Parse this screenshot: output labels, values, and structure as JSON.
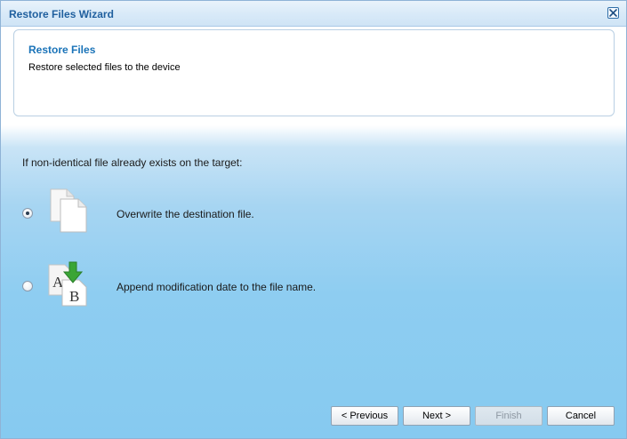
{
  "window": {
    "title": "Restore Files Wizard"
  },
  "header": {
    "title": "Restore Files",
    "subtitle": "Restore selected files to the device"
  },
  "question": "If non-identical file already exists on the target:",
  "options": [
    {
      "label": "Overwrite the destination file.",
      "selected": true,
      "icon": "overwrite-files-icon"
    },
    {
      "label": "Append modification date to the file name.",
      "selected": false,
      "icon": "append-date-icon"
    }
  ],
  "buttons": {
    "previous": "< Previous",
    "next": "Next >",
    "finish": "Finish",
    "cancel": "Cancel"
  },
  "colors": {
    "title": "#1f5f9e",
    "header_title": "#1a73b8",
    "append_arrow": "#3aa536"
  }
}
